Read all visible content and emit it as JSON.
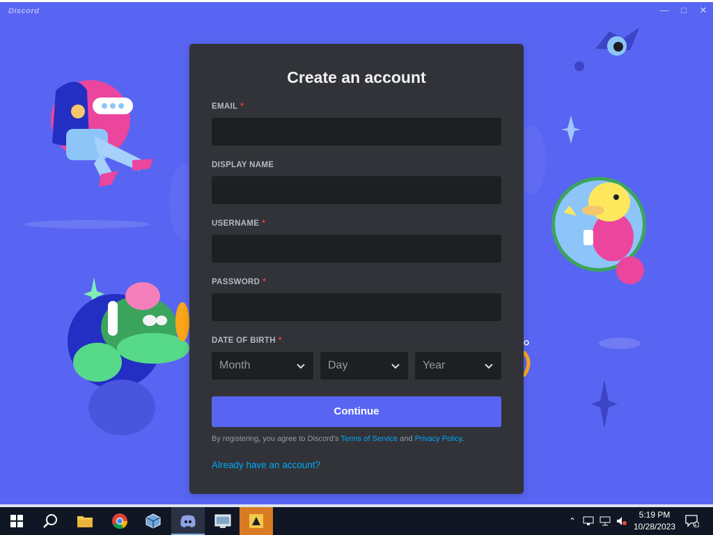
{
  "window": {
    "app_name": "Discord",
    "title_bar_buttons": [
      "minimize-icon",
      "maximize-icon",
      "close-icon"
    ]
  },
  "form": {
    "title": "Create an account",
    "fields": [
      {
        "label": "EMAIL",
        "required": true,
        "value": ""
      },
      {
        "label": "DISPLAY NAME",
        "required": false,
        "value": ""
      },
      {
        "label": "USERNAME",
        "required": true,
        "value": ""
      },
      {
        "label": "PASSWORD",
        "required": true,
        "value": ""
      }
    ],
    "dob": {
      "label": "DATE OF BIRTH",
      "required": true,
      "month_placeholder": "Month",
      "day_placeholder": "Day",
      "year_placeholder": "Year"
    },
    "required_mark": "*",
    "continue_label": "Continue",
    "terms_prefix": "By registering, you agree to Discord's ",
    "terms_link": "Terms of Service",
    "terms_and": " and ",
    "privacy_link": "Privacy Policy",
    "terms_suffix": ".",
    "login_link": "Already have an account?"
  },
  "taskbar": {
    "items": [
      "windows-start-icon",
      "search-icon",
      "file-explorer-icon",
      "chrome-icon",
      "virtualbox-icon",
      "discord-icon",
      "control-panel-icon",
      "pinned-app-icon"
    ],
    "clock_time": "5:19 PM",
    "clock_date": "10/28/2023",
    "notification_count": "1"
  },
  "colors": {
    "background": "#5865F2",
    "card": "#313338",
    "input": "#1E1F22",
    "accent": "#5865F2",
    "link": "#00A8FC",
    "required": "#F23F43"
  }
}
